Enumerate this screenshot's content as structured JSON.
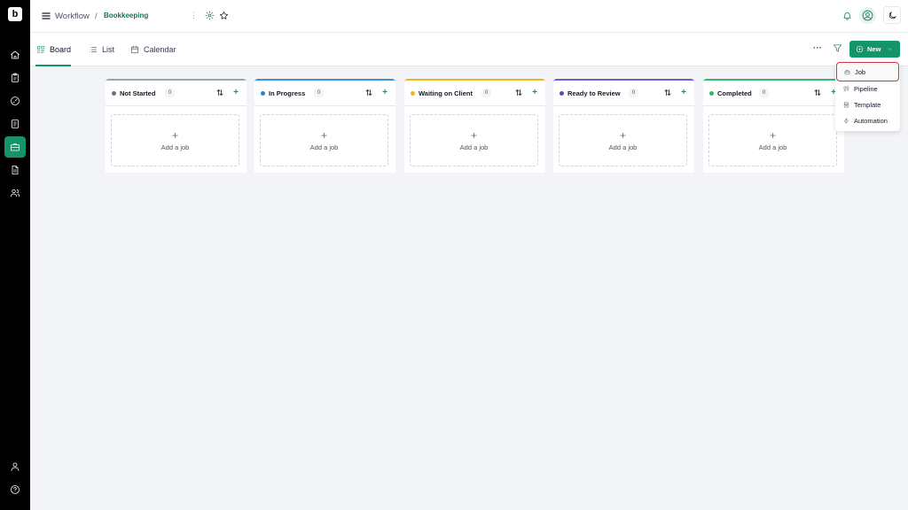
{
  "sidebar": {
    "logo_text": "b",
    "items": [
      {
        "icon": "home-icon",
        "active": false
      },
      {
        "icon": "clipboard-icon",
        "active": false
      },
      {
        "icon": "gauge-icon",
        "active": false
      },
      {
        "icon": "notes-icon",
        "active": false
      },
      {
        "icon": "briefcase-icon",
        "active": true
      },
      {
        "icon": "document-icon",
        "active": false
      },
      {
        "icon": "users-icon",
        "active": false
      }
    ],
    "bottom": [
      {
        "icon": "user-icon"
      },
      {
        "icon": "help-icon"
      }
    ]
  },
  "header": {
    "breadcrumb": [
      "Workflow",
      "Bookkeeping"
    ],
    "separator": "/",
    "more": "⋮"
  },
  "tabs": [
    {
      "label": "Board",
      "icon": "board-icon",
      "active": true
    },
    {
      "label": "List",
      "icon": "list-icon",
      "active": false
    },
    {
      "label": "Calendar",
      "icon": "calendar-icon",
      "active": false
    }
  ],
  "toolbar": {
    "more": "···",
    "new_label": "New"
  },
  "columns": [
    {
      "title": "Not Started",
      "count": "0",
      "color": "#9ca3af",
      "add_label": "Add a job"
    },
    {
      "title": "In Progress",
      "count": "0",
      "color": "#3b93d9",
      "add_label": "Add a job"
    },
    {
      "title": "Waiting on Client",
      "count": "0",
      "color": "#f2b416",
      "add_label": "Add a job"
    },
    {
      "title": "Ready to Review",
      "count": "0",
      "color": "#6d5bd0",
      "add_label": "Add a job"
    },
    {
      "title": "Completed",
      "count": "0",
      "color": "#33b96a",
      "add_label": "Add a job"
    }
  ],
  "new_menu": {
    "items": [
      {
        "label": "Job",
        "icon": "briefcase-icon",
        "highlighted": true
      },
      {
        "label": "Pipeline",
        "icon": "pipeline-icon",
        "highlighted": false
      },
      {
        "label": "Template",
        "icon": "template-icon",
        "highlighted": false
      },
      {
        "label": "Automation",
        "icon": "bolt-icon",
        "highlighted": false
      }
    ]
  },
  "colors": {
    "accent": "#15936b",
    "accent_dark": "#17734f",
    "highlight_border": "#d0353d"
  }
}
